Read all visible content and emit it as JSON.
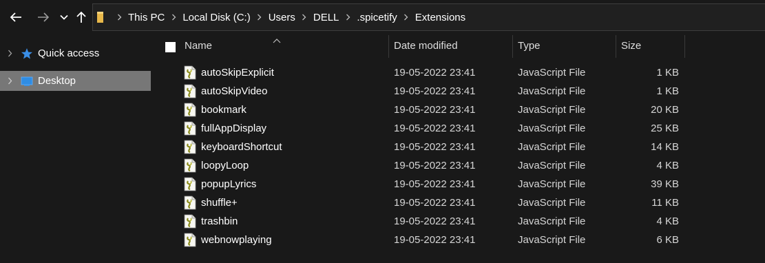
{
  "window": {
    "accent_selected": "#777777",
    "background": "#191919"
  },
  "toolbar": {
    "back_icon": "arrow-left-icon",
    "forward_icon": "arrow-right-icon",
    "recent_icon": "chevron-down-icon",
    "up_icon": "arrow-up-icon"
  },
  "address": {
    "folder_icon": "folder-icon",
    "breadcrumbs": [
      "This PC",
      "Local Disk (C:)",
      "Users",
      "DELL",
      ".spicetify",
      "Extensions"
    ]
  },
  "nav": {
    "items": [
      {
        "label": "Quick access",
        "icon": "star-icon",
        "selected": false
      },
      {
        "label": "Desktop",
        "icon": "desktop-icon",
        "selected": true
      }
    ]
  },
  "columns": {
    "name": "Name",
    "date": "Date modified",
    "type": "Type",
    "size": "Size"
  },
  "files": [
    {
      "name": "autoSkipExplicit",
      "date": "19-05-2022 23:41",
      "type": "JavaScript File",
      "size": "1 KB"
    },
    {
      "name": "autoSkipVideo",
      "date": "19-05-2022 23:41",
      "type": "JavaScript File",
      "size": "1 KB"
    },
    {
      "name": "bookmark",
      "date": "19-05-2022 23:41",
      "type": "JavaScript File",
      "size": "20 KB"
    },
    {
      "name": "fullAppDisplay",
      "date": "19-05-2022 23:41",
      "type": "JavaScript File",
      "size": "25 KB"
    },
    {
      "name": "keyboardShortcut",
      "date": "19-05-2022 23:41",
      "type": "JavaScript File",
      "size": "14 KB"
    },
    {
      "name": "loopyLoop",
      "date": "19-05-2022 23:41",
      "type": "JavaScript File",
      "size": "4 KB"
    },
    {
      "name": "popupLyrics",
      "date": "19-05-2022 23:41",
      "type": "JavaScript File",
      "size": "39 KB"
    },
    {
      "name": "shuffle+",
      "date": "19-05-2022 23:41",
      "type": "JavaScript File",
      "size": "11 KB"
    },
    {
      "name": "trashbin",
      "date": "19-05-2022 23:41",
      "type": "JavaScript File",
      "size": "4 KB"
    },
    {
      "name": "webnowplaying",
      "date": "19-05-2022 23:41",
      "type": "JavaScript File",
      "size": "6 KB"
    }
  ]
}
